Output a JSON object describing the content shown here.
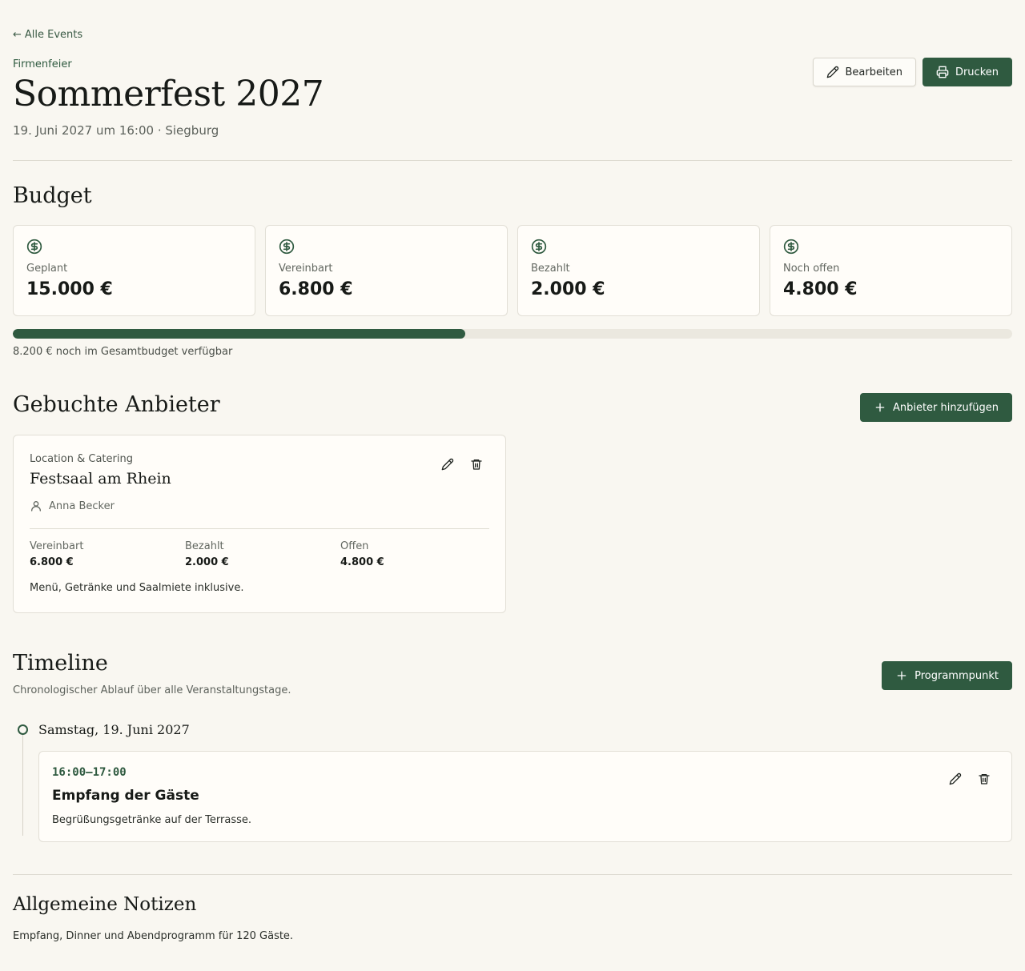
{
  "nav": {
    "back_arrow": "←",
    "back_label": "Alle Events"
  },
  "event": {
    "category": "Firmenfeier",
    "title": "Sommerfest 2027",
    "subtitle": "19. Juni 2027 um 16:00 · Siegburg"
  },
  "actions": {
    "edit_label": "Bearbeiten",
    "print_label": "Drucken"
  },
  "budget": {
    "heading": "Budget",
    "cards": [
      {
        "icon": "dollar-circle-icon",
        "label": "Geplant",
        "value": "15.000 €"
      },
      {
        "icon": "dollar-circle-icon",
        "label": "Vereinbart",
        "value": "6.800 €"
      },
      {
        "icon": "dollar-circle-icon",
        "label": "Bezahlt",
        "value": "2.000 €"
      },
      {
        "icon": "dollar-circle-icon",
        "label": "Noch offen",
        "value": "4.800 €"
      }
    ],
    "progress_fraction": 0.453,
    "progress_text": "8.200 € noch im Gesamtbudget verfügbar"
  },
  "vendors": {
    "heading": "Gebuchte Anbieter",
    "add_label": "Anbieter hinzufügen",
    "items": [
      {
        "category": "Location & Catering",
        "name": "Festsaal am Rhein",
        "contact": "Anna Becker",
        "stats": [
          {
            "label": "Vereinbart",
            "value": "6.800 €"
          },
          {
            "label": "Bezahlt",
            "value": "2.000 €"
          },
          {
            "label": "Offen",
            "value": "4.800 €"
          }
        ],
        "note": "Menü, Getränke und Saalmiete inklusive."
      }
    ]
  },
  "timeline": {
    "heading": "Timeline",
    "subtitle": "Chronologischer Ablauf über alle Veranstaltungstage.",
    "add_label": "Programmpunkt",
    "days": [
      {
        "label": "Samstag, 19. Juni 2027",
        "items": [
          {
            "time": "16:00–17:00",
            "title": "Empfang der Gäste",
            "description": "Begrüßungsgetränke auf der Terrasse."
          }
        ]
      }
    ]
  },
  "notes": {
    "heading": "Allgemeine Notizen",
    "text": "Empfang, Dinner und Abendprogramm für 120 Gäste."
  },
  "colors": {
    "accent": "#2f5a40",
    "background": "#f9f7f1",
    "card": "#fffdf9",
    "border": "#e2dfd6"
  }
}
